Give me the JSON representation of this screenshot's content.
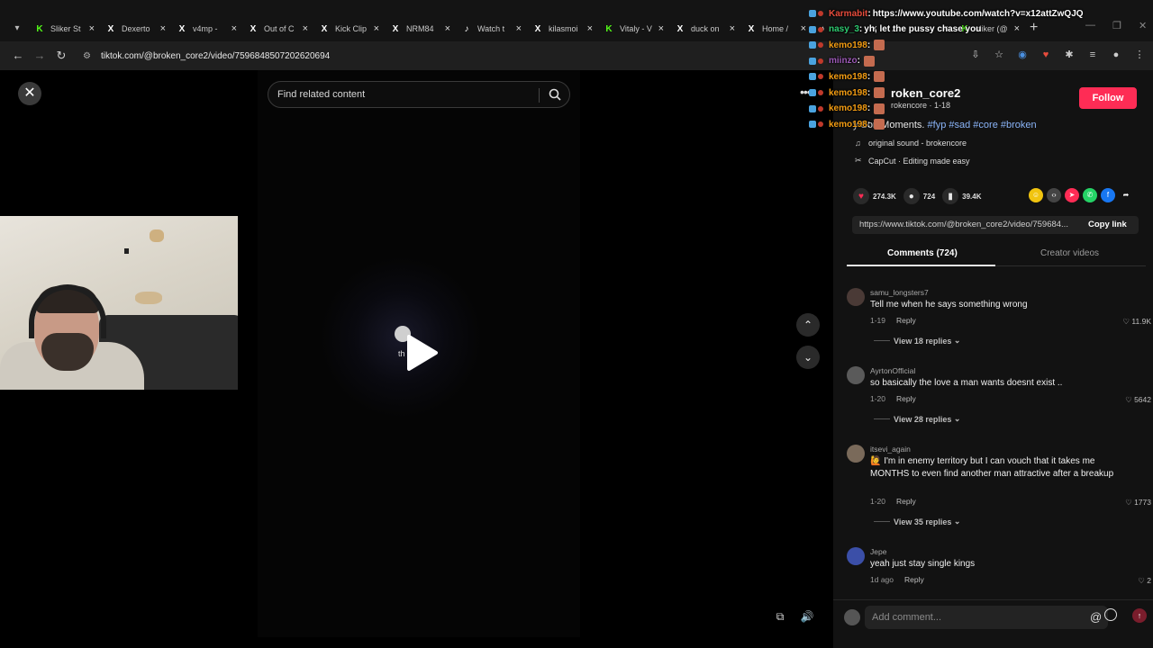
{
  "browser": {
    "tabs": [
      {
        "icon": "K",
        "icon_color": "#53fc18",
        "label": "Sliker St"
      },
      {
        "icon": "X",
        "icon_color": "#ffffff",
        "label": "Dexerto"
      },
      {
        "icon": "X",
        "icon_color": "#ffffff",
        "label": "v4mp -"
      },
      {
        "icon": "X",
        "icon_color": "#ffffff",
        "label": "Out of C"
      },
      {
        "icon": "X",
        "icon_color": "#ffffff",
        "label": "Kick Clip"
      },
      {
        "icon": "X",
        "icon_color": "#ffffff",
        "label": "NRM84"
      },
      {
        "icon": "♪",
        "icon_color": "#ffffff",
        "label": "Watch t"
      },
      {
        "icon": "X",
        "icon_color": "#ffffff",
        "label": "kilasmoi"
      },
      {
        "icon": "K",
        "icon_color": "#53fc18",
        "label": "Vitaly - V"
      },
      {
        "icon": "X",
        "icon_color": "#ffffff",
        "label": "duck on"
      },
      {
        "icon": "X",
        "icon_color": "#ffffff",
        "label": "Home /"
      },
      {
        "icon": "♪",
        "icon_color": "#ffffff",
        "label": ""
      },
      {
        "icon": "♪",
        "icon_color": "#ffffff",
        "label": ""
      },
      {
        "icon": "K",
        "icon_color": "#53fc18",
        "label": "sliker (@"
      }
    ],
    "url": "tiktok.com/@broken_core2/video/7596848507202620694"
  },
  "video": {
    "search_placeholder": "Find related content",
    "play_overlay_text": "th"
  },
  "author": {
    "name": "roken_core2",
    "sub": "rokencore · 1-18",
    "follow_label": "Follow"
  },
  "description": {
    "text": "y Son Moments. ",
    "tags": "#fyp #sad #core #broken"
  },
  "music": "original sound - brokencore",
  "capcut": "CapCut · Editing made easy",
  "stats": {
    "likes": "274.3K",
    "comments": "724",
    "saves": "39.4K"
  },
  "share_link": {
    "url": "https://www.tiktok.com/@broken_core2/video/759684...",
    "copy_label": "Copy link"
  },
  "comment_tabs": {
    "active": "Comments (724)",
    "other": "Creator videos"
  },
  "comments": [
    {
      "user": "samu_longsters7",
      "text": "Tell me when he says something wrong",
      "date": "1-19",
      "reply": "Reply",
      "likes": "11.9K",
      "replies": "View 18 replies"
    },
    {
      "user": "AyrtonOfficial",
      "text": "so basically the love a man wants doesnt exist ..",
      "date": "1-20",
      "reply": "Reply",
      "likes": "5642",
      "replies": "View 28 replies"
    },
    {
      "user": "itsevi_again",
      "text": "🙋 I'm in enemy territory but I can vouch that it takes me MONTHS to even find another man attractive after a breakup",
      "date": "1-20",
      "reply": "Reply",
      "likes": "1773",
      "replies": "View 35 replies"
    },
    {
      "user": "Jepe",
      "text": "yeah just stay single kings",
      "date": "1d ago",
      "reply": "Reply",
      "likes": "2",
      "replies": ""
    }
  ],
  "add_comment_placeholder": "Add comment...",
  "chat": [
    {
      "user": "Karmabit",
      "user_color": "#e74c3c",
      "msg": "https://www.youtube.com/watch?v=x12attZwQJQ",
      "emote": false
    },
    {
      "user": "nasy_3",
      "user_color": "#2ecc71",
      "msg": "yh, let the pussy chase you",
      "emote": false
    },
    {
      "user": "kemo198",
      "user_color": "#f39c12",
      "msg": "",
      "emote": true
    },
    {
      "user": "miinzo",
      "user_color": "#9b59b6",
      "msg": "",
      "emote": true
    },
    {
      "user": "kemo198",
      "user_color": "#f39c12",
      "msg": "",
      "emote": true
    },
    {
      "user": "kemo198",
      "user_color": "#f39c12",
      "msg": "",
      "emote": true
    },
    {
      "user": "kemo198",
      "user_color": "#f39c12",
      "msg": "",
      "emote": true
    },
    {
      "user": "kemo198",
      "user_color": "#f39c12",
      "msg": "",
      "emote": true
    }
  ]
}
